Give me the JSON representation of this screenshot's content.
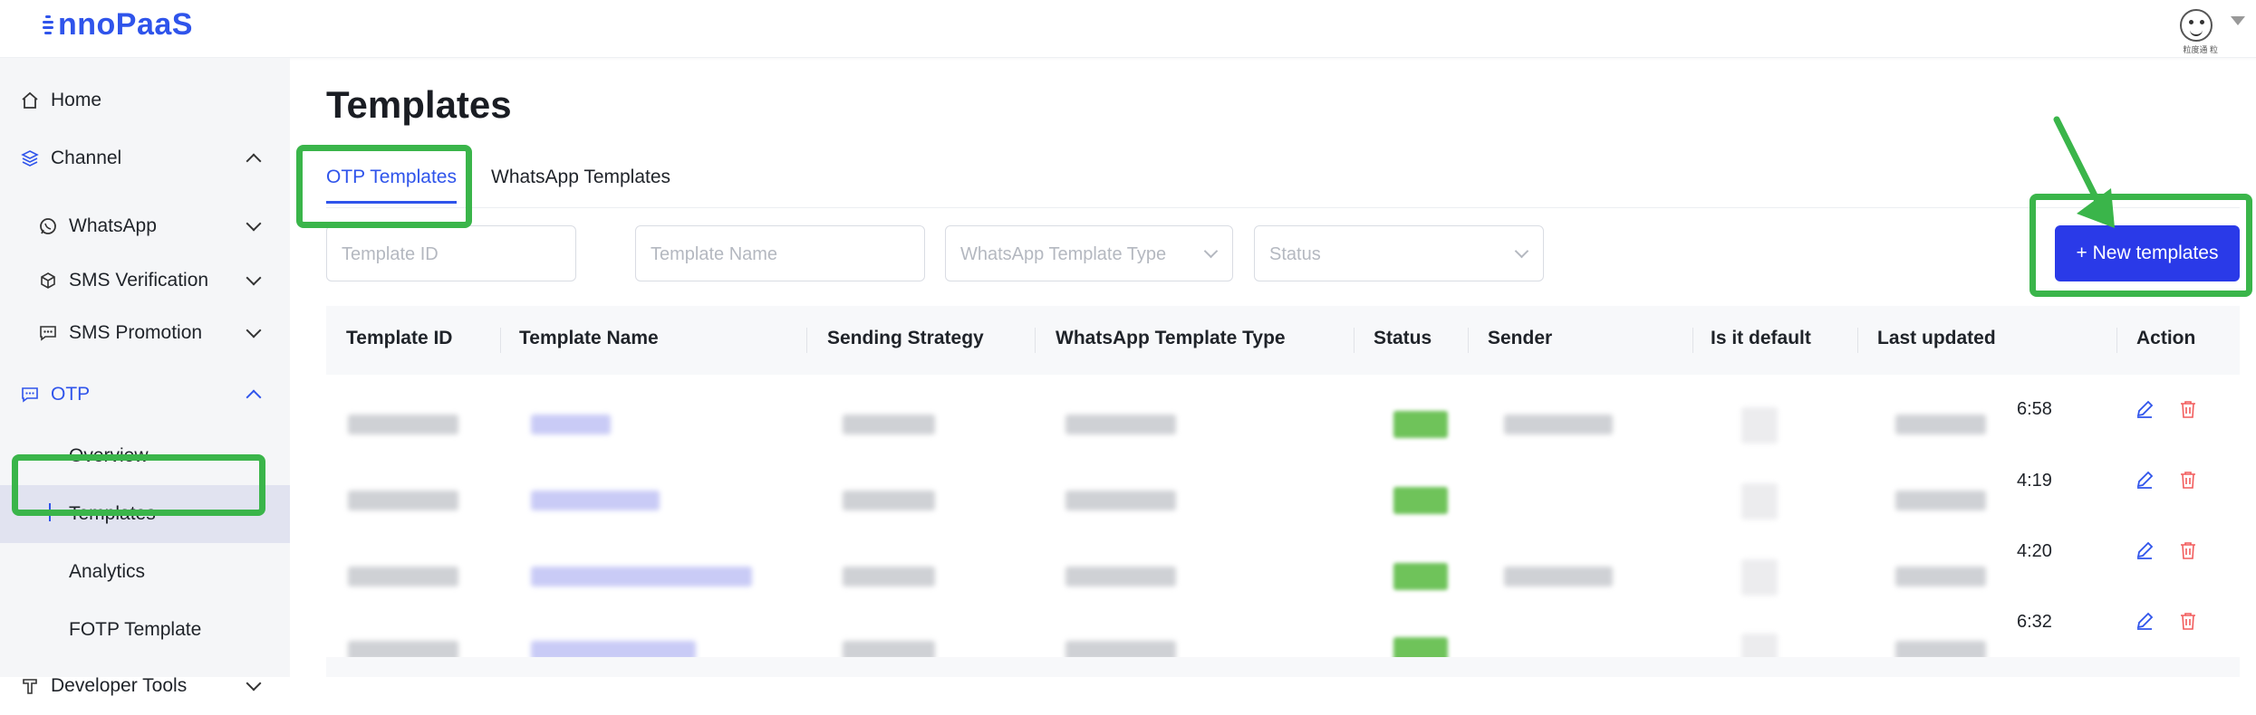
{
  "app": {
    "logo_text": "nnoPaaS"
  },
  "header": {
    "avatar_caption": "粒度通 粒"
  },
  "sidebar": {
    "items": [
      {
        "label": "Home",
        "icon": "home-icon"
      },
      {
        "label": "Channel",
        "icon": "layers-icon"
      },
      {
        "label": "WhatsApp",
        "icon": "whatsapp-icon"
      },
      {
        "label": "SMS Verification",
        "icon": "cube-icon"
      },
      {
        "label": "SMS Promotion",
        "icon": "message-dots-icon"
      },
      {
        "label": "OTP",
        "icon": "chat-icon"
      },
      {
        "label": "Overview"
      },
      {
        "label": "Templates"
      },
      {
        "label": "Analytics"
      },
      {
        "label": "FOTP Template"
      },
      {
        "label": "Developer Tools",
        "icon": "tool-icon"
      }
    ]
  },
  "main": {
    "title": "Templates",
    "tabs": [
      {
        "label": "OTP Templates",
        "active": true
      },
      {
        "label": "WhatsApp Templates",
        "active": false
      }
    ],
    "filters": {
      "template_id_placeholder": "Template ID",
      "template_name_placeholder": "Template Name",
      "type_placeholder": "WhatsApp Template Type",
      "status_placeholder": "Status"
    },
    "new_button": "+ New templates",
    "table": {
      "columns": [
        "Template ID",
        "Template Name",
        "Sending Strategy",
        "WhatsApp Template Type",
        "Status",
        "Sender",
        "Is it default",
        "Last updated",
        "Action"
      ],
      "rows": [
        {
          "last_updated": "6:58"
        },
        {
          "last_updated": "4:19"
        },
        {
          "last_updated": "4:20"
        },
        {
          "last_updated": "6:32"
        }
      ]
    }
  },
  "colors": {
    "accent": "#2f54eb",
    "button": "#2a3ae8",
    "highlight": "#3ab54a",
    "delete": "#f25c5c"
  }
}
